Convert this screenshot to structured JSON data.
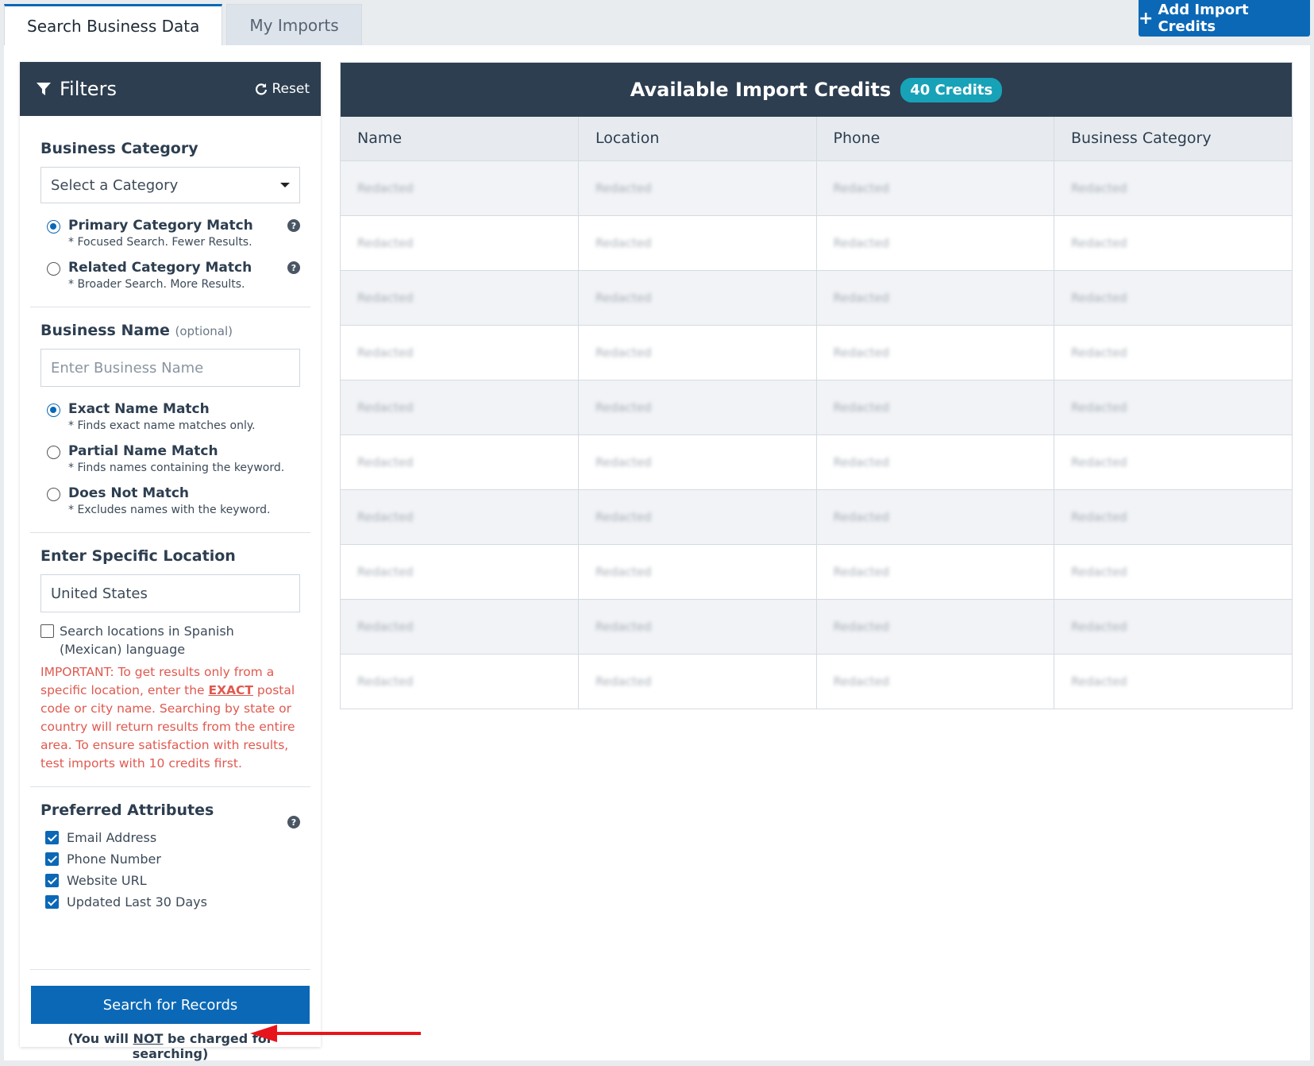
{
  "tabs": [
    {
      "label": "Search Business Data",
      "active": true
    },
    {
      "label": "My Imports",
      "active": false
    }
  ],
  "header": {
    "add_credits_label": "Add Import Credits"
  },
  "filters": {
    "title": "Filters",
    "reset_label": "Reset",
    "category": {
      "label": "Business Category",
      "select_value": "Select a Category",
      "options": [
        {
          "title": "Primary Category Match",
          "sub": "* Focused Search. Fewer Results.",
          "selected": true
        },
        {
          "title": "Related Category Match",
          "sub": "* Broader Search. More Results.",
          "selected": false
        }
      ]
    },
    "name": {
      "label": "Business Name",
      "optional": "(optional)",
      "placeholder": "Enter Business Name",
      "options": [
        {
          "title": "Exact Name Match",
          "sub": "* Finds exact name matches only.",
          "selected": true
        },
        {
          "title": "Partial Name Match",
          "sub": "* Finds names containing the keyword.",
          "selected": false
        },
        {
          "title": "Does Not Match",
          "sub": "* Excludes names with the keyword.",
          "selected": false
        }
      ]
    },
    "location": {
      "label": "Enter Specific Location",
      "value": "United States",
      "spanish_label": "Search locations in Spanish (Mexican) language",
      "important_prefix": "IMPORTANT:",
      "important_part1": " To get results only from a specific location, enter the ",
      "important_exact": "EXACT",
      "important_part2": " postal code or city name. Searching by state or country will return results from the entire area. To ensure satisfaction with results, test imports with 10 credits first."
    },
    "attributes": {
      "label": "Preferred Attributes",
      "items": [
        {
          "label": "Email Address",
          "checked": true
        },
        {
          "label": "Phone Number",
          "checked": true
        },
        {
          "label": "Website URL",
          "checked": true
        },
        {
          "label": "Updated Last 30 Days",
          "checked": true
        }
      ]
    },
    "search_button": "Search for Records",
    "note_pre": "(You will ",
    "note_not": "NOT",
    "note_post": " be charged for searching)"
  },
  "results": {
    "title": "Available Import Credits",
    "credits_badge": "40 Credits",
    "columns": [
      "Name",
      "Location",
      "Phone",
      "Business Category"
    ],
    "cell_text": "Redacted",
    "row_count": 10
  }
}
